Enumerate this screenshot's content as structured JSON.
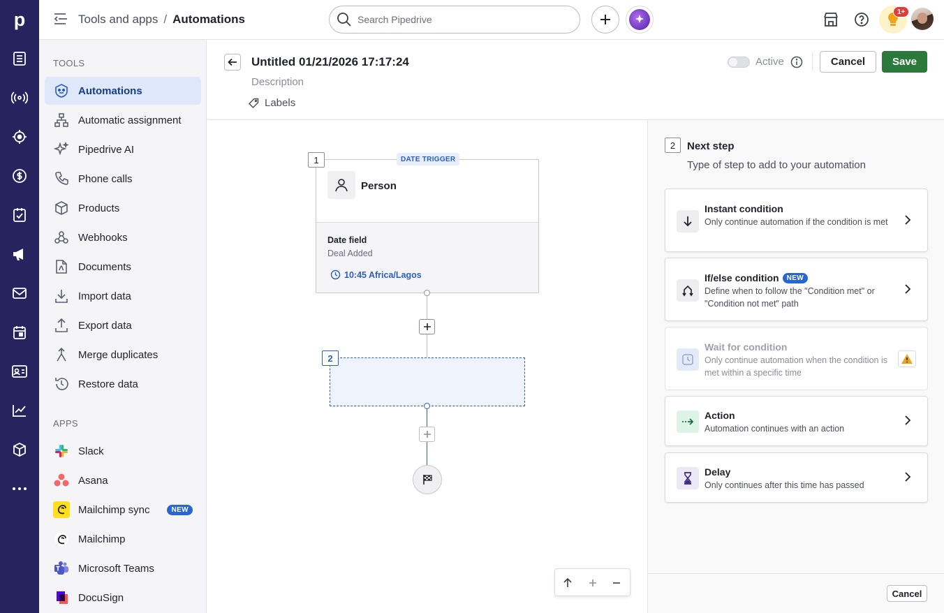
{
  "app": {
    "logo_letter": "p"
  },
  "topbar": {
    "breadcrumb_parent": "Tools and apps",
    "breadcrumb_sep": "/",
    "breadcrumb_current": "Automations",
    "search_placeholder": "Search Pipedrive",
    "notif_count": "1+"
  },
  "sidebar": {
    "tools_heading": "TOOLS",
    "apps_heading": "APPS",
    "tools": [
      {
        "label": "Automations",
        "icon": "robot-icon"
      },
      {
        "label": "Automatic assignment",
        "icon": "hierarchy-icon"
      },
      {
        "label": "Pipedrive AI",
        "icon": "sparkle-icon"
      },
      {
        "label": "Phone calls",
        "icon": "phone-icon"
      },
      {
        "label": "Products",
        "icon": "box-icon"
      },
      {
        "label": "Webhooks",
        "icon": "webhook-icon"
      },
      {
        "label": "Documents",
        "icon": "document-icon"
      },
      {
        "label": "Import data",
        "icon": "import-icon"
      },
      {
        "label": "Export data",
        "icon": "export-icon"
      },
      {
        "label": "Merge duplicates",
        "icon": "merge-icon"
      },
      {
        "label": "Restore data",
        "icon": "restore-icon"
      }
    ],
    "apps": [
      {
        "label": "Slack",
        "icon": "slack-icon"
      },
      {
        "label": "Asana",
        "icon": "asana-icon"
      },
      {
        "label": "Mailchimp sync",
        "icon": "mailchimp-icon",
        "badge": "NEW"
      },
      {
        "label": "Mailchimp",
        "icon": "mailchimp-icon"
      },
      {
        "label": "Microsoft Teams",
        "icon": "teams-icon"
      },
      {
        "label": "DocuSign",
        "icon": "docusign-icon"
      }
    ]
  },
  "editor": {
    "title": "Untitled 01/21/2026 17:17:24",
    "description": "Description",
    "labels": "Labels",
    "active_label": "Active",
    "cancel": "Cancel",
    "save": "Save"
  },
  "canvas": {
    "trigger_num": "1",
    "trigger_badge": "DATE TRIGGER",
    "trigger_entity": "Person",
    "date_field_label": "Date field",
    "date_field_value": "Deal Added",
    "time_value": "10:45 Africa/Lagos",
    "step2_num": "2"
  },
  "panel": {
    "step_num": "2",
    "step_title": "Next step",
    "step_subtitle": "Type of step to add to your automation",
    "cancel": "Cancel",
    "options": [
      {
        "title": "Instant condition",
        "desc": "Only continue automation if the condition is met",
        "icon": "arrow-down-icon"
      },
      {
        "title": "If/else condition",
        "badge": "NEW",
        "desc": "Define when to follow the \"Condition met\" or \"Condition not met\" path",
        "icon": "branch-icon"
      },
      {
        "title": "Wait for condition",
        "desc": "Only continue automation when the condition is met within a specific time",
        "icon": "clock-icon",
        "disabled": true
      },
      {
        "title": "Action",
        "desc": "Automation continues with an action",
        "icon": "action-arrow-icon"
      },
      {
        "title": "Delay",
        "desc": "Only continues after this time has passed",
        "icon": "hourglass-icon"
      }
    ]
  },
  "colors": {
    "rail": "#26235f",
    "save": "#2b7a3b",
    "accent": "#2b5ebd"
  }
}
